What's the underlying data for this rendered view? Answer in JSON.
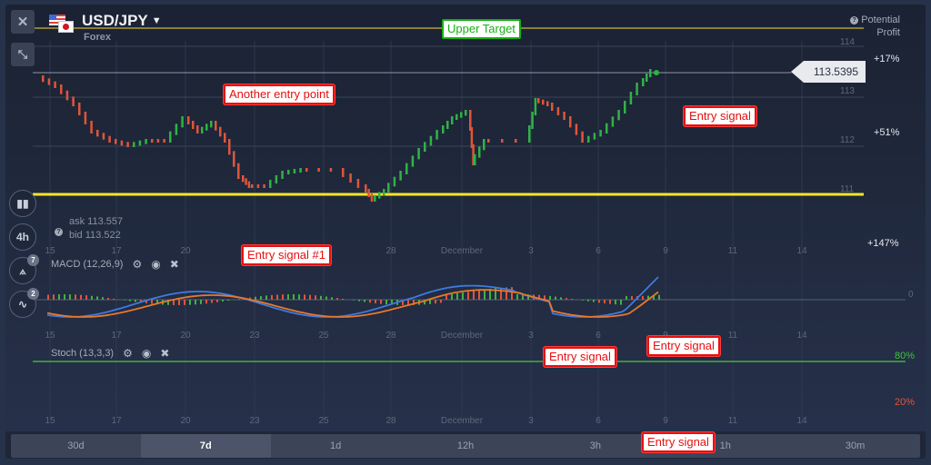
{
  "header": {
    "pair": "USD/JPY",
    "category": "Forex",
    "close_icon": "close-icon",
    "collapse_icon": "collapse-icon",
    "potential_profit_line1": "Potential",
    "potential_profit_line2": "Profit"
  },
  "profit_scale": {
    "top": "+17%",
    "middle": "+51%",
    "bottom": "+147%"
  },
  "current_price": "113.5395",
  "quote": {
    "ask": "ask 113.557",
    "bid": "bid 113.522"
  },
  "sidebar": {
    "chart_type_icon": "candlestick-icon",
    "timeframe": "4h",
    "tools_badge": "7",
    "indicators_badge": "2"
  },
  "main_chart": {
    "y_ticks": [
      "114",
      "113",
      "112",
      "111"
    ],
    "x_ticks": [
      "15",
      "17",
      "20",
      "23",
      "25",
      "28",
      "December",
      "3",
      "6",
      "9",
      "11",
      "14"
    ],
    "support_level": 111.0,
    "upper_target_level": 114.35,
    "colors": {
      "up": "#2fb344",
      "down": "#e0553a",
      "support": "#f5e52a",
      "target": "#8a7e3a"
    }
  },
  "macd": {
    "label": "MACD (12,26,9)",
    "zero_label": "0",
    "colors": {
      "macd": "#3d7be0",
      "signal": "#e8782a"
    }
  },
  "stoch": {
    "label": "Stoch (13,3,3)",
    "upper": "80%",
    "lower": "20%",
    "colors": {
      "k": "#2ec4d6",
      "d": "#e0553a",
      "upper_line": "#43b043",
      "lower_line": "#d9492f"
    }
  },
  "annotations": {
    "upper_target": "Upper Target",
    "another_entry": "Another entry point",
    "entry_signal_top": "Entry signal",
    "entry_signal_1": "Entry signal #1",
    "entry_signal_macd_a": "Entry signal",
    "entry_signal_macd_b": "Entry signal",
    "entry_signal_bottom": "Entry signal"
  },
  "timeframes": [
    {
      "label": "30d",
      "active": false
    },
    {
      "label": "7d",
      "active": true
    },
    {
      "label": "1d",
      "active": false
    },
    {
      "label": "12h",
      "active": false
    },
    {
      "label": "3h",
      "active": false
    },
    {
      "label": "1h",
      "active": false
    },
    {
      "label": "30m",
      "active": false
    }
  ]
}
